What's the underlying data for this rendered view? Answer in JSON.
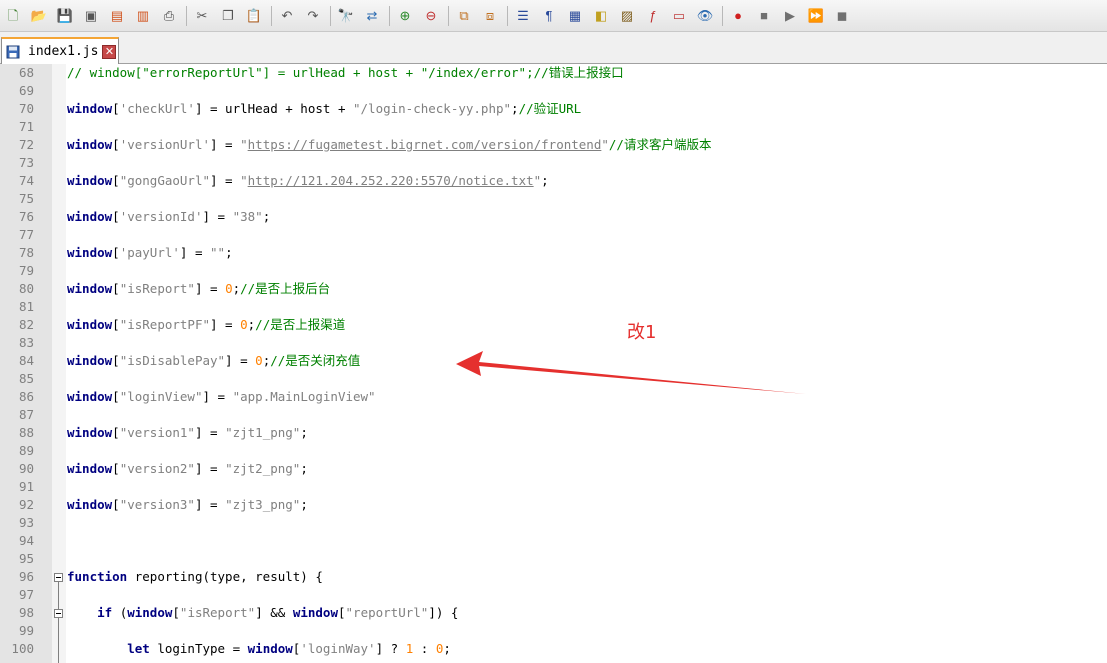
{
  "tab": {
    "label": "index1.js",
    "close_glyph": "✕"
  },
  "annotation": {
    "text": "改1",
    "color": "#e5302e"
  },
  "colors": {
    "keyword": "#000080",
    "string": "#808080",
    "number": "#ff8000",
    "comment": "#008000"
  },
  "lines": [
    {
      "n": "68",
      "segs": [
        {
          "t": "cm",
          "v": "// window[\"errorReportUrl\"] = urlHead + host + \"/index/error\";//错误上报接口"
        }
      ]
    },
    {
      "n": "69",
      "segs": []
    },
    {
      "n": "70",
      "segs": [
        {
          "t": "kw",
          "v": "window"
        },
        {
          "t": "p",
          "v": "["
        },
        {
          "t": "str",
          "v": "'checkUrl'"
        },
        {
          "t": "p",
          "v": "] = urlHead + host + "
        },
        {
          "t": "str",
          "v": "\"/login-check-yy.php\""
        },
        {
          "t": "p",
          "v": ";"
        },
        {
          "t": "cm",
          "v": "//验证URL"
        }
      ]
    },
    {
      "n": "71",
      "segs": []
    },
    {
      "n": "72",
      "segs": [
        {
          "t": "kw",
          "v": "window"
        },
        {
          "t": "p",
          "v": "["
        },
        {
          "t": "str",
          "v": "'versionUrl'"
        },
        {
          "t": "p",
          "v": "] = "
        },
        {
          "t": "str",
          "v": "\""
        },
        {
          "t": "url",
          "v": "https://fugametest.bigrnet.com/version/frontend"
        },
        {
          "t": "str",
          "v": "\""
        },
        {
          "t": "cm",
          "v": "//请求客户端版本"
        }
      ]
    },
    {
      "n": "73",
      "segs": []
    },
    {
      "n": "74",
      "segs": [
        {
          "t": "kw",
          "v": "window"
        },
        {
          "t": "p",
          "v": "["
        },
        {
          "t": "str",
          "v": "\"gongGaoUrl\""
        },
        {
          "t": "p",
          "v": "] = "
        },
        {
          "t": "str",
          "v": "\""
        },
        {
          "t": "url",
          "v": "http://121.204.252.220:5570/notice.txt"
        },
        {
          "t": "str",
          "v": "\""
        },
        {
          "t": "p",
          "v": ";"
        }
      ]
    },
    {
      "n": "75",
      "segs": []
    },
    {
      "n": "76",
      "segs": [
        {
          "t": "kw",
          "v": "window"
        },
        {
          "t": "p",
          "v": "["
        },
        {
          "t": "str",
          "v": "'versionId'"
        },
        {
          "t": "p",
          "v": "] = "
        },
        {
          "t": "str",
          "v": "\"38\""
        },
        {
          "t": "p",
          "v": ";"
        }
      ]
    },
    {
      "n": "77",
      "segs": []
    },
    {
      "n": "78",
      "segs": [
        {
          "t": "kw",
          "v": "window"
        },
        {
          "t": "p",
          "v": "["
        },
        {
          "t": "str",
          "v": "'payUrl'"
        },
        {
          "t": "p",
          "v": "] = "
        },
        {
          "t": "str",
          "v": "\"\""
        },
        {
          "t": "p",
          "v": ";"
        }
      ]
    },
    {
      "n": "79",
      "segs": []
    },
    {
      "n": "80",
      "segs": [
        {
          "t": "kw",
          "v": "window"
        },
        {
          "t": "p",
          "v": "["
        },
        {
          "t": "str",
          "v": "\"isReport\""
        },
        {
          "t": "p",
          "v": "] = "
        },
        {
          "t": "num",
          "v": "0"
        },
        {
          "t": "p",
          "v": ";"
        },
        {
          "t": "cm",
          "v": "//是否上报后台"
        }
      ]
    },
    {
      "n": "81",
      "segs": []
    },
    {
      "n": "82",
      "segs": [
        {
          "t": "kw",
          "v": "window"
        },
        {
          "t": "p",
          "v": "["
        },
        {
          "t": "str",
          "v": "\"isReportPF\""
        },
        {
          "t": "p",
          "v": "] = "
        },
        {
          "t": "num",
          "v": "0"
        },
        {
          "t": "p",
          "v": ";"
        },
        {
          "t": "cm",
          "v": "//是否上报渠道"
        }
      ]
    },
    {
      "n": "83",
      "segs": []
    },
    {
      "n": "84",
      "segs": [
        {
          "t": "kw",
          "v": "window"
        },
        {
          "t": "p",
          "v": "["
        },
        {
          "t": "str",
          "v": "\"isDisablePay\""
        },
        {
          "t": "p",
          "v": "] = "
        },
        {
          "t": "num",
          "v": "0"
        },
        {
          "t": "p",
          "v": ";"
        },
        {
          "t": "cm",
          "v": "//是否关闭充值"
        }
      ]
    },
    {
      "n": "85",
      "segs": []
    },
    {
      "n": "86",
      "segs": [
        {
          "t": "kw",
          "v": "window"
        },
        {
          "t": "p",
          "v": "["
        },
        {
          "t": "str",
          "v": "\"loginView\""
        },
        {
          "t": "p",
          "v": "] = "
        },
        {
          "t": "str",
          "v": "\"app.MainLoginView\""
        }
      ]
    },
    {
      "n": "87",
      "segs": []
    },
    {
      "n": "88",
      "segs": [
        {
          "t": "kw",
          "v": "window"
        },
        {
          "t": "p",
          "v": "["
        },
        {
          "t": "str",
          "v": "\"version1\""
        },
        {
          "t": "p",
          "v": "] = "
        },
        {
          "t": "str",
          "v": "\"zjt1_png\""
        },
        {
          "t": "p",
          "v": ";"
        }
      ]
    },
    {
      "n": "89",
      "segs": []
    },
    {
      "n": "90",
      "segs": [
        {
          "t": "kw",
          "v": "window"
        },
        {
          "t": "p",
          "v": "["
        },
        {
          "t": "str",
          "v": "\"version2\""
        },
        {
          "t": "p",
          "v": "] = "
        },
        {
          "t": "str",
          "v": "\"zjt2_png\""
        },
        {
          "t": "p",
          "v": ";"
        }
      ]
    },
    {
      "n": "91",
      "segs": []
    },
    {
      "n": "92",
      "segs": [
        {
          "t": "kw",
          "v": "window"
        },
        {
          "t": "p",
          "v": "["
        },
        {
          "t": "str",
          "v": "\"version3\""
        },
        {
          "t": "p",
          "v": "] = "
        },
        {
          "t": "str",
          "v": "\"zjt3_png\""
        },
        {
          "t": "p",
          "v": ";"
        }
      ]
    },
    {
      "n": "93",
      "segs": []
    },
    {
      "n": "94",
      "segs": []
    },
    {
      "n": "95",
      "segs": []
    },
    {
      "n": "96",
      "segs": [
        {
          "t": "kw",
          "v": "function"
        },
        {
          "t": "p",
          "v": " reporting(type, result) {"
        }
      ]
    },
    {
      "n": "97",
      "segs": []
    },
    {
      "n": "98",
      "segs": [
        {
          "t": "p",
          "v": "    "
        },
        {
          "t": "kw",
          "v": "if"
        },
        {
          "t": "p",
          "v": " ("
        },
        {
          "t": "kw",
          "v": "window"
        },
        {
          "t": "p",
          "v": "["
        },
        {
          "t": "str",
          "v": "\"isReport\""
        },
        {
          "t": "p",
          "v": "] && "
        },
        {
          "t": "kw",
          "v": "window"
        },
        {
          "t": "p",
          "v": "["
        },
        {
          "t": "str",
          "v": "\"reportUrl\""
        },
        {
          "t": "p",
          "v": "]) {"
        }
      ]
    },
    {
      "n": "99",
      "segs": []
    },
    {
      "n": "100",
      "segs": [
        {
          "t": "p",
          "v": "        "
        },
        {
          "t": "kw",
          "v": "let"
        },
        {
          "t": "p",
          "v": " loginType = "
        },
        {
          "t": "kw",
          "v": "window"
        },
        {
          "t": "p",
          "v": "["
        },
        {
          "t": "str",
          "v": "'loginWay'"
        },
        {
          "t": "p",
          "v": "] ? "
        },
        {
          "t": "num",
          "v": "1"
        },
        {
          "t": "p",
          "v": " : "
        },
        {
          "t": "num",
          "v": "0"
        },
        {
          "t": "p",
          "v": ";"
        }
      ]
    }
  ],
  "toolbar": [
    {
      "name": "new-file-icon",
      "g": "🗋",
      "c": "#3a7a2a"
    },
    {
      "name": "open-file-icon",
      "g": "📂",
      "c": "#c98a1a"
    },
    {
      "name": "save-icon",
      "g": "💾",
      "c": "#555"
    },
    {
      "name": "save-all-icon",
      "g": "▣",
      "c": "#555"
    },
    {
      "name": "close-file-icon",
      "g": "▤",
      "c": "#d0501a"
    },
    {
      "name": "close-all-icon",
      "g": "▥",
      "c": "#d0501a"
    },
    {
      "name": "print-icon",
      "g": "⎙",
      "c": "#444"
    },
    {
      "sep": true
    },
    {
      "name": "cut-icon",
      "g": "✂",
      "c": "#555"
    },
    {
      "name": "copy-icon",
      "g": "❐",
      "c": "#555"
    },
    {
      "name": "paste-icon",
      "g": "📋",
      "c": "#a07030"
    },
    {
      "sep": true
    },
    {
      "name": "undo-icon",
      "g": "↶",
      "c": "#555"
    },
    {
      "name": "redo-icon",
      "g": "↷",
      "c": "#555"
    },
    {
      "sep": true
    },
    {
      "name": "find-icon",
      "g": "🔭",
      "c": "#333"
    },
    {
      "name": "replace-icon",
      "g": "⇄",
      "c": "#2a6ab0"
    },
    {
      "sep": true
    },
    {
      "name": "zoom-in-icon",
      "g": "⊕",
      "c": "#2a8a2a"
    },
    {
      "name": "zoom-out-icon",
      "g": "⊖",
      "c": "#c03030"
    },
    {
      "sep": true
    },
    {
      "name": "sync-vertical-icon",
      "g": "⧉",
      "c": "#c07020"
    },
    {
      "name": "sync-horizontal-icon",
      "g": "⧈",
      "c": "#c07020"
    },
    {
      "sep": true
    },
    {
      "name": "word-wrap-icon",
      "g": "☰",
      "c": "#2a4a9a"
    },
    {
      "name": "show-all-chars-icon",
      "g": "¶",
      "c": "#2a4a9a"
    },
    {
      "name": "indent-guide-icon",
      "g": "▦",
      "c": "#2a4a9a"
    },
    {
      "name": "udl-icon",
      "g": "◧",
      "c": "#c0a020"
    },
    {
      "name": "doc-map-icon",
      "g": "▨",
      "c": "#806020"
    },
    {
      "name": "function-list-icon",
      "g": "ƒ",
      "c": "#c03030"
    },
    {
      "name": "folder-workspace-icon",
      "g": "▭",
      "c": "#c04040"
    },
    {
      "name": "monitor-icon",
      "g": "👁",
      "c": "#2a6ab0"
    },
    {
      "sep": true
    },
    {
      "name": "record-macro-icon",
      "g": "●",
      "c": "#d02020"
    },
    {
      "name": "stop-macro-icon",
      "g": "■",
      "c": "#707070"
    },
    {
      "name": "play-macro-icon",
      "g": "▶",
      "c": "#707070"
    },
    {
      "name": "run-macro-multiple-icon",
      "g": "⏩",
      "c": "#2a4ab0"
    },
    {
      "name": "save-macro-icon",
      "g": "◼",
      "c": "#707070"
    }
  ]
}
